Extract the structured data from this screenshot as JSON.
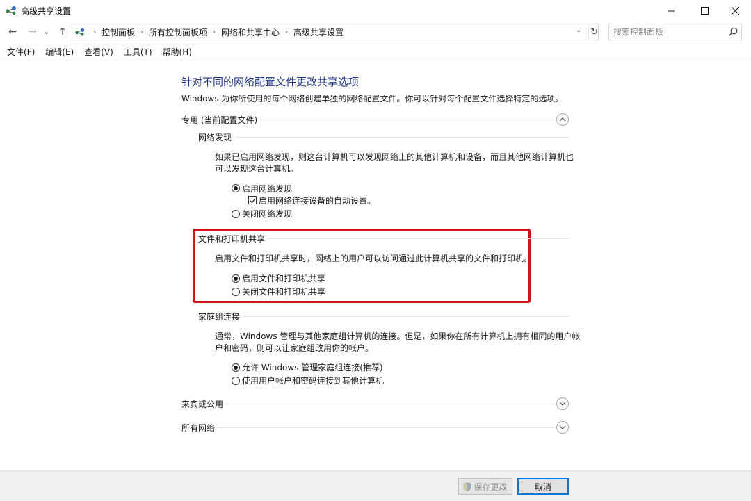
{
  "window": {
    "title": "高级共享设置",
    "controls": {
      "minimize": "—",
      "maximize": "☐",
      "close": "✕"
    }
  },
  "navigation": {
    "back": "←",
    "forward": "→",
    "recent": "⌄",
    "up": "↑",
    "breadcrumbs": [
      "控制面板",
      "所有控制面板项",
      "网络和共享中心",
      "高级共享设置"
    ],
    "dropdown": "⌄",
    "refresh": "↻",
    "search_placeholder": "搜索控制面板"
  },
  "menu": [
    "文件(F)",
    "编辑(E)",
    "查看(V)",
    "工具(T)",
    "帮助(H)"
  ],
  "content": {
    "heading": "针对不同的网络配置文件更改共享选项",
    "intro": "Windows 为你所使用的每个网络创建单独的网络配置文件。你可以针对每个配置文件选择特定的选项。",
    "profile_private": {
      "title": "专用 (当前配置文件)",
      "network_discovery": {
        "title": "网络发现",
        "desc_line1": "如果已启用网络发现，则这台计算机可以发现网络上的其他计算机和设备，而且其他网络计算机也",
        "desc_line2": "可以发现这台计算机。",
        "opt_on": "启用网络发现",
        "opt_auto": "启用网络连接设备的自动设置。",
        "opt_off": "关闭网络发现",
        "selected": "on",
        "auto_checked": true
      },
      "file_printer": {
        "title": "文件和打印机共享",
        "desc": "启用文件和打印机共享时，网络上的用户可以访问通过此计算机共享的文件和打印机。",
        "opt_on": "启用文件和打印机共享",
        "opt_off": "关闭文件和打印机共享",
        "selected": "on"
      },
      "homegroup": {
        "title": "家庭组连接",
        "desc_line1": "通常，Windows 管理与其他家庭组计算机的连接。但是，如果你在所有计算机上拥有相同的用户帐",
        "desc_line2": "户和密码，则可以让家庭组改用你的帐户。",
        "opt_allow": "允许 Windows 管理家庭组连接(推荐)",
        "opt_user": "使用用户帐户和密码连接到其他计算机",
        "selected": "allow"
      }
    },
    "profile_guest": {
      "title": "来宾或公用"
    },
    "profile_all": {
      "title": "所有网络"
    }
  },
  "footer": {
    "save_label": "保存更改",
    "cancel_label": "取消"
  },
  "colors": {
    "heading": "#1e3287",
    "highlight_border": "#d0121b",
    "focus_border": "#0078d7"
  }
}
